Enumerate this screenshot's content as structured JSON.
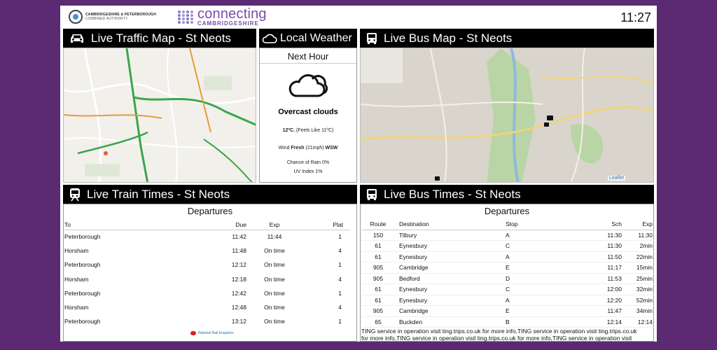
{
  "header": {
    "ca_name_line1": "CAMBRIDGESHIRE & PETERBOROUGH",
    "ca_name_line2": "COMBINED AUTHORITY",
    "brand_main": "connecting",
    "brand_sub": "CAMBRIDGESHIRE",
    "clock": "11:27"
  },
  "traffic": {
    "title": "Live Traffic Map - St Neots"
  },
  "weather": {
    "title": "Local Weather",
    "period": "Next Hour",
    "icon": "cloud-icon",
    "condition": "Overcast clouds",
    "temp": "12ºC.",
    "feels": "(Feels Like 11ºC)",
    "wind_prefix": "Wind",
    "wind_strength": "Fresh",
    "wind_speed": "(21mph)",
    "wind_dir": "WSW",
    "rain": "Chance of Rain 0%",
    "uv": "UV Index 1%"
  },
  "busmap": {
    "title": "Live Bus Map - St Neots",
    "attribution": "Leaflet"
  },
  "trains": {
    "title": "Live Train Times - St Neots",
    "subtitle": "Departures",
    "headers": {
      "to": "To",
      "due": "Due",
      "exp": "Exp",
      "plat": "Plat"
    },
    "rows": [
      {
        "to": "Peterborough",
        "due": "11:42",
        "exp": "11:44",
        "plat": "1"
      },
      {
        "to": "Horsham",
        "due": "11:48",
        "exp": "On time",
        "plat": "4"
      },
      {
        "to": "Peterborough",
        "due": "12:12",
        "exp": "On time",
        "plat": "1"
      },
      {
        "to": "Horsham",
        "due": "12:18",
        "exp": "On time",
        "plat": "4"
      },
      {
        "to": "Peterborough",
        "due": "12:42",
        "exp": "On time",
        "plat": "1"
      },
      {
        "to": "Horsham",
        "due": "12:48",
        "exp": "On time",
        "plat": "4"
      },
      {
        "to": "Peterborough",
        "due": "13:12",
        "exp": "On time",
        "plat": "1"
      }
    ],
    "footer": "National Rail Enquiries"
  },
  "buses": {
    "title": "Live Bus Times - St Neots",
    "subtitle": "Departures",
    "headers": {
      "route": "Route",
      "dest": "Destination",
      "stop": "Stop",
      "sch": "Sch",
      "exp": "Exp"
    },
    "rows": [
      {
        "route": "150",
        "dest": "Tilbury",
        "stop": "A",
        "sch": "11:30",
        "exp": "11:30"
      },
      {
        "route": "61",
        "dest": "Eynesbury",
        "stop": "C",
        "sch": "11:30",
        "exp": "2min"
      },
      {
        "route": "61",
        "dest": "Eynesbury",
        "stop": "A",
        "sch": "11:50",
        "exp": "22min"
      },
      {
        "route": "905",
        "dest": "Cambridge",
        "stop": "E",
        "sch": "11:17",
        "exp": "15min"
      },
      {
        "route": "905",
        "dest": "Bedford",
        "stop": "D",
        "sch": "11:53",
        "exp": "25min"
      },
      {
        "route": "61",
        "dest": "Eynesbury",
        "stop": "C",
        "sch": "12:00",
        "exp": "32min"
      },
      {
        "route": "61",
        "dest": "Eynesbury",
        "stop": "A",
        "sch": "12:20",
        "exp": "52min"
      },
      {
        "route": "905",
        "dest": "Cambridge",
        "stop": "E",
        "sch": "11:47",
        "exp": "34min"
      },
      {
        "route": "65",
        "dest": "Buckden",
        "stop": "B",
        "sch": "12:14",
        "exp": "12:14"
      }
    ],
    "ticker_line1": "TING service in operation visit ting.trips.co.uk for more info,TING service in operation visit ting.trips.co.uk",
    "ticker_line2": "for more info,TING service in operation visit ting.trips.co.uk for more info,TING service in operation visit ting.trips."
  },
  "colors": {
    "brand_purple": "#5b2a72",
    "header_black": "#000000",
    "traffic_green": "#3aa64a",
    "road_orange": "#e89a3a"
  }
}
